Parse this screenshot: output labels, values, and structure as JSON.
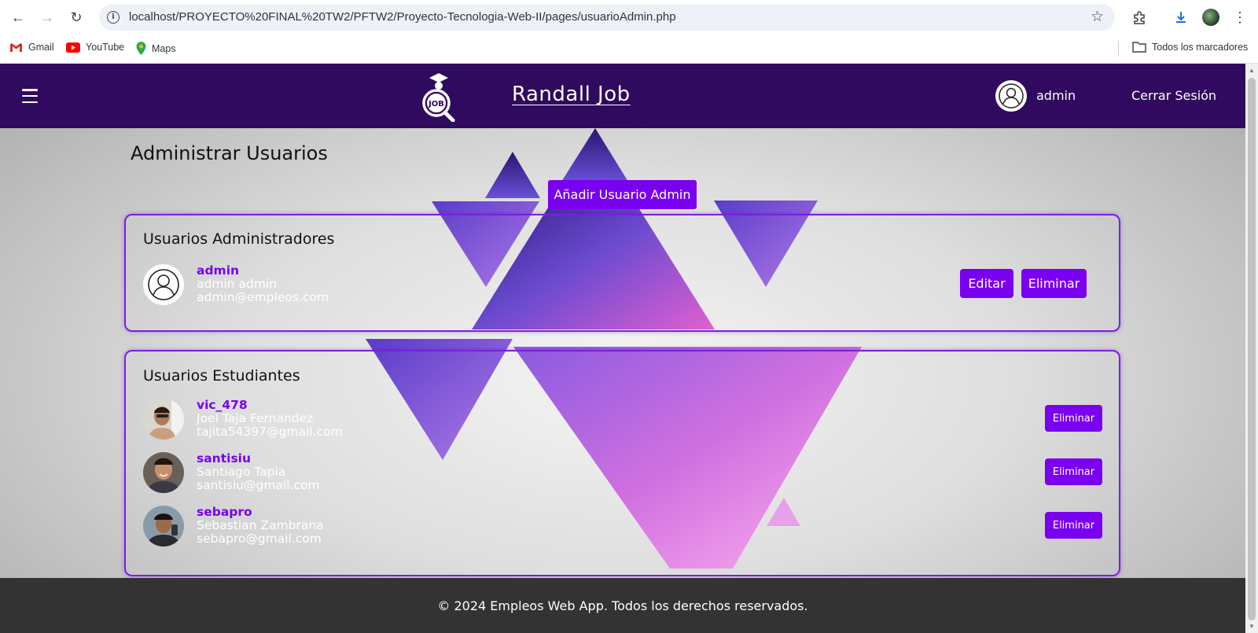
{
  "browser": {
    "url": "localhost/PROYECTO%20FINAL%20TW2/PFTW2/Proyecto-Tecnologia-Web-II/pages/usuarioAdmin.php",
    "bookmarks": [
      {
        "label": "Gmail",
        "icon": "gmail-icon"
      },
      {
        "label": "YouTube",
        "icon": "youtube-icon"
      },
      {
        "label": "Maps",
        "icon": "maps-icon"
      }
    ],
    "all_bookmarks": "Todos los marcadores"
  },
  "header": {
    "brand": "Randall Job",
    "logo_text": "JOB",
    "username": "admin",
    "logout": "Cerrar Sesión"
  },
  "page": {
    "title": "Administrar Usuarios",
    "add_admin_button": "Añadir Usuario Admin"
  },
  "admins": {
    "title": "Usuarios Administradores",
    "users": [
      {
        "username": "admin",
        "full_name": "admin admin",
        "email": "admin@empleos.com",
        "edit": "Editar",
        "delete": "Eliminar"
      }
    ]
  },
  "students": {
    "title": "Usuarios Estudiantes",
    "users": [
      {
        "username": "vic_478",
        "full_name": "Joel Taja Fernandez",
        "email": "tajita54397@gmail.com",
        "delete": "Eliminar"
      },
      {
        "username": "santisiu",
        "full_name": "Santiago Tapia",
        "email": "santisiu@gmail.com",
        "delete": "Eliminar"
      },
      {
        "username": "sebapro",
        "full_name": "Sebastian Zambrana",
        "email": "sebapro@gmail.com",
        "delete": "Eliminar"
      }
    ]
  },
  "footer": {
    "text": "© 2024 Empleos Web App. Todos los derechos reservados."
  },
  "colors": {
    "header_bg": "#300a5e",
    "accent": "#7a00f0",
    "footer_bg": "#333333"
  }
}
